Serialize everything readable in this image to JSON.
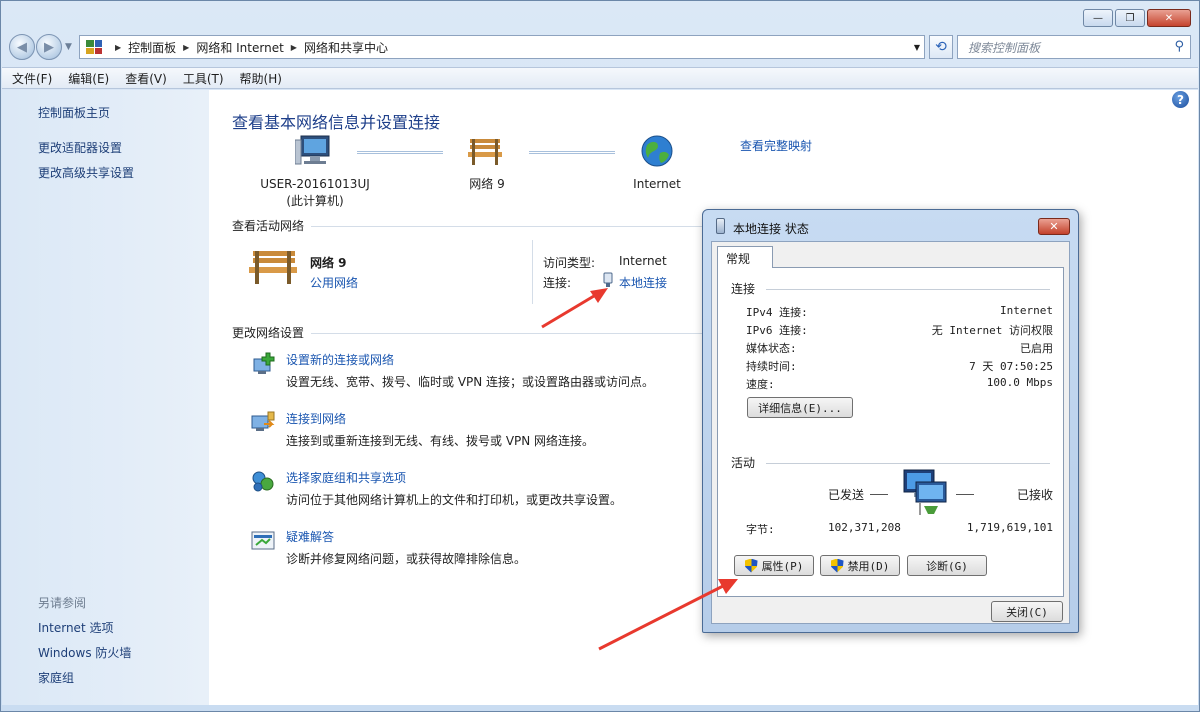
{
  "window": {
    "caption_buttons": [
      "minimize",
      "restore",
      "close"
    ],
    "caption_glyphs": {
      "minimize": "—",
      "restore": "❐",
      "close": "✕"
    }
  },
  "nav": {
    "back_glyph": "◀",
    "forward_glyph": "▶",
    "breadcrumb": [
      "控制面板",
      "网络和 Internet",
      "网络和共享中心"
    ],
    "crumb_sep": "▶",
    "dropdown_glyph": "▼",
    "refresh_glyph": "⟲",
    "search_placeholder": "搜索控制面板",
    "search_glyph": "⚲"
  },
  "menu": [
    "文件(F)",
    "编辑(E)",
    "查看(V)",
    "工具(T)",
    "帮助(H)"
  ],
  "sidebar": {
    "links": [
      "控制面板主页",
      "更改适配器设置",
      "更改高级共享设置"
    ],
    "see_also_heading": "另请参阅",
    "see_also": [
      "Internet 选项",
      "Windows 防火墙",
      "家庭组"
    ]
  },
  "main": {
    "help_glyph": "?",
    "title": "查看基本网络信息并设置连接",
    "full_map_link": "查看完整映射",
    "nodes": {
      "computer_name": "USER-20161013UJ",
      "computer_sub": "(此计算机)",
      "network": "网络 9",
      "internet": "Internet"
    },
    "active_section": "查看活动网络",
    "active": {
      "name": "网络 9",
      "type": "公用网络",
      "access_label": "访问类型:",
      "access_value": "Internet",
      "conn_label": "连接:",
      "conn_value": "本地连接"
    },
    "change_section": "更改网络设置",
    "tasks": [
      {
        "title": "设置新的连接或网络",
        "desc": "设置无线、宽带、拨号、临时或 VPN 连接；或设置路由器或访问点。"
      },
      {
        "title": "连接到网络",
        "desc": "连接到或重新连接到无线、有线、拨号或 VPN 网络连接。"
      },
      {
        "title": "选择家庭组和共享选项",
        "desc": "访问位于其他网络计算机上的文件和打印机，或更改共享设置。"
      },
      {
        "title": "疑难解答",
        "desc": "诊断并修复网络问题，或获得故障排除信息。"
      }
    ]
  },
  "dialog": {
    "title": "本地连接 状态",
    "close_glyph": "✕",
    "tab": "常规",
    "connection_group": "连接",
    "rows": [
      {
        "label": "IPv4 连接:",
        "value": "Internet"
      },
      {
        "label": "IPv6 连接:",
        "value": "无 Internet 访问权限"
      },
      {
        "label": "媒体状态:",
        "value": "已启用"
      },
      {
        "label": "持续时间:",
        "value": "7 天 07:50:25"
      },
      {
        "label": "速度:",
        "value": "100.0 Mbps"
      }
    ],
    "details_button": "详细信息(E)...",
    "activity_group": "活动",
    "sent_label": "已发送",
    "received_label": "已接收",
    "bytes_label": "字节:",
    "bytes_sent": "102,371,208",
    "bytes_received": "1,719,619,101",
    "buttons": {
      "properties": "属性(P)",
      "disable": "禁用(D)",
      "diagnose": "诊断(G)",
      "close": "关闭(C)"
    }
  },
  "colors": {
    "link": "#1a56b0",
    "heading": "#1e3f8a",
    "arrow": "#e8392e"
  }
}
